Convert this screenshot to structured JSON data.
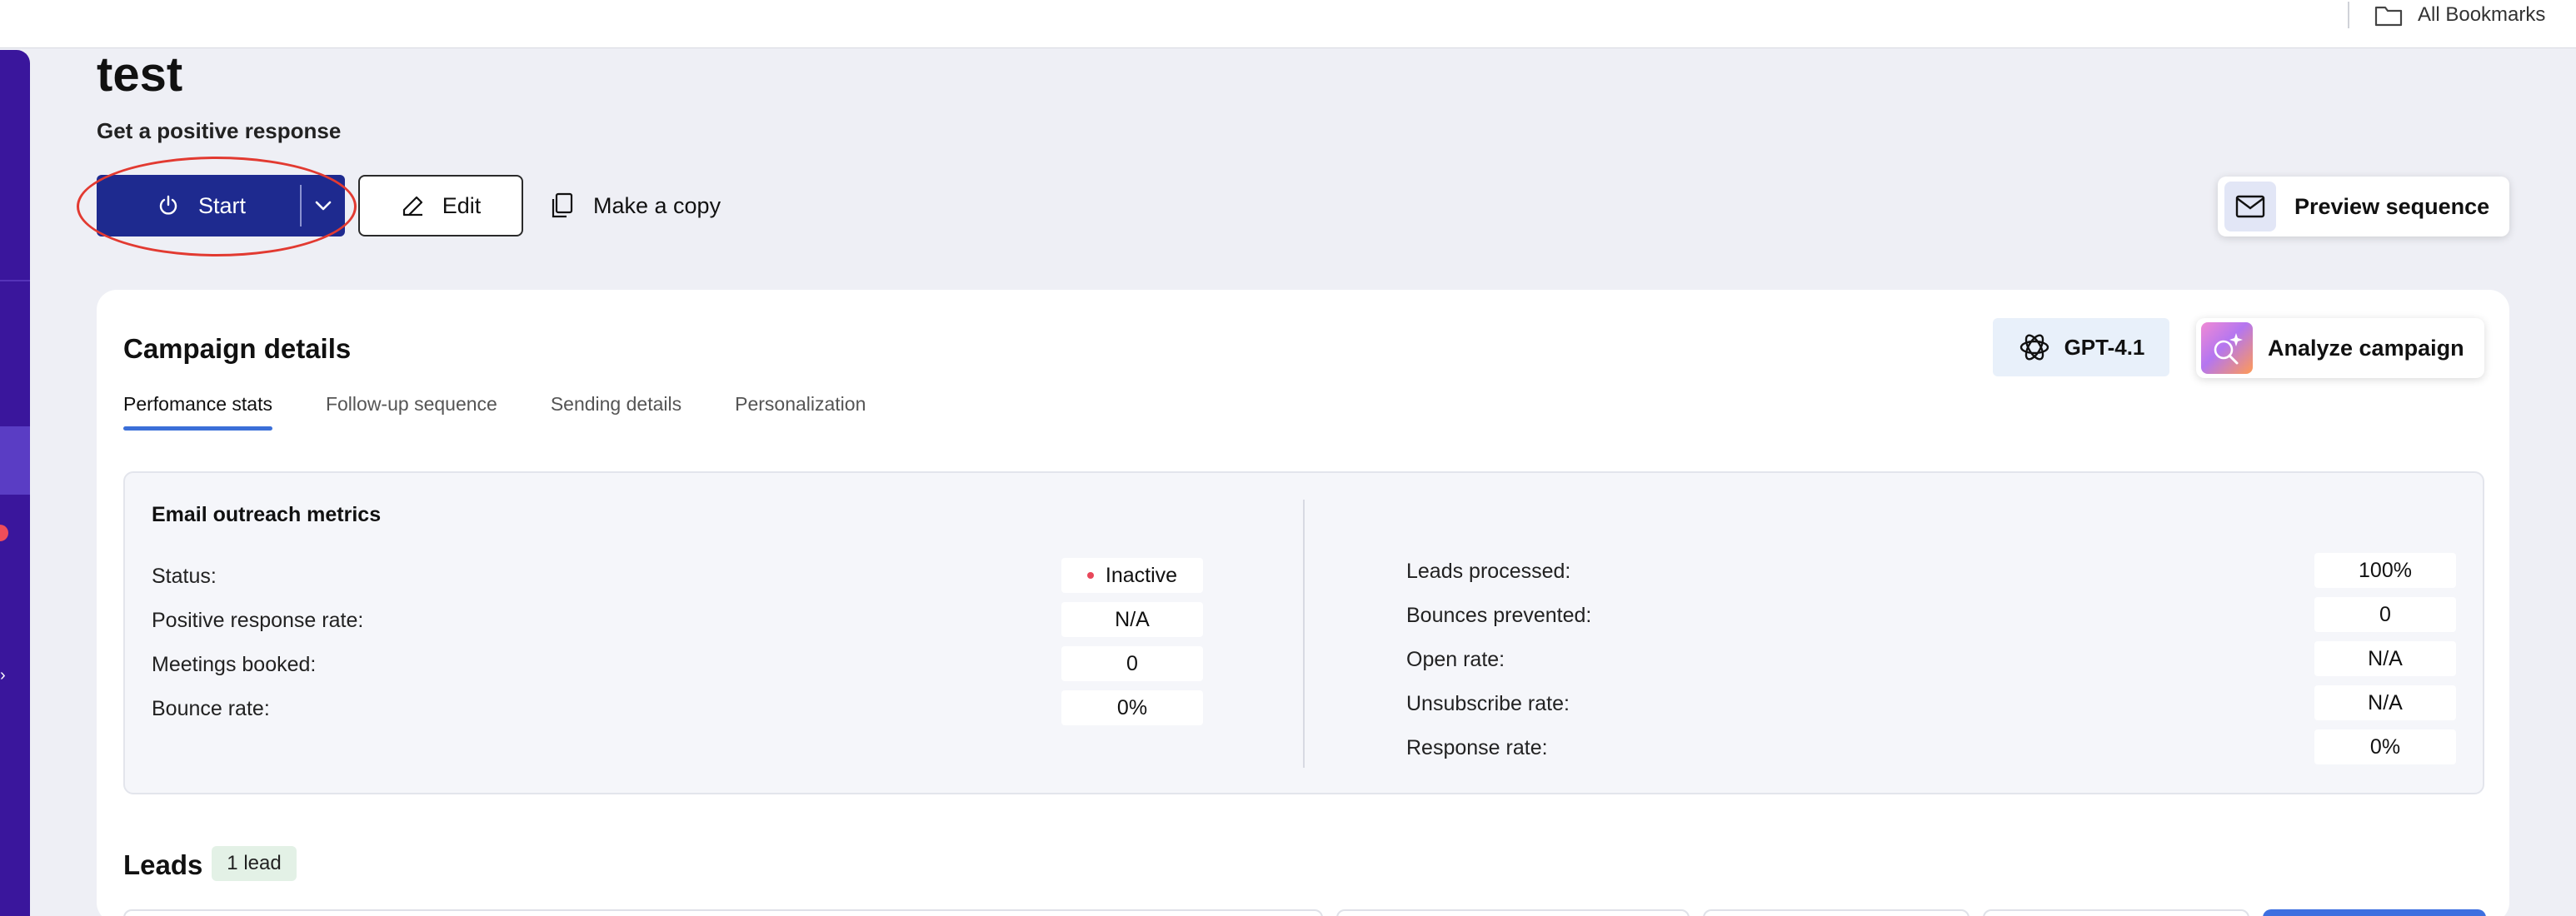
{
  "bookmarks": {
    "label": "All Bookmarks",
    "icon": "folder-icon"
  },
  "page": {
    "title": "test",
    "subtitle": "Get a positive response"
  },
  "actions": {
    "start_label": "Start",
    "edit_label": "Edit",
    "copy_label": "Make a copy",
    "preview_label": "Preview sequence"
  },
  "campaign": {
    "title": "Campaign details",
    "gpt_label": "GPT-4.1",
    "analyze_label": "Analyze campaign",
    "tabs": [
      {
        "label": "Perfomance stats",
        "active": true
      },
      {
        "label": "Follow-up sequence",
        "active": false
      },
      {
        "label": "Sending details",
        "active": false
      },
      {
        "label": "Personalization",
        "active": false
      }
    ],
    "metrics": {
      "title": "Email outreach metrics",
      "left": [
        {
          "label": "Status:",
          "value": "Inactive"
        },
        {
          "label": "Positive response rate:",
          "value": "N/A"
        },
        {
          "label": "Meetings booked:",
          "value": "0"
        },
        {
          "label": "Bounce rate:",
          "value": "0%"
        }
      ],
      "right": [
        {
          "label": "Leads processed:",
          "value": "100%"
        },
        {
          "label": "Bounces prevented:",
          "value": "0"
        },
        {
          "label": "Open rate:",
          "value": "N/A"
        },
        {
          "label": "Unsubscribe rate:",
          "value": "N/A"
        },
        {
          "label": "Response rate:",
          "value": "0%"
        }
      ]
    }
  },
  "leads": {
    "title": "Leads",
    "badge": "1 lead"
  },
  "colors": {
    "sidebar": "#3a169c",
    "start_button": "#1e2a8f",
    "active_tab_underline": "#3b6fd8",
    "highlight_ellipse": "#e23a31",
    "status_inactive_dot": "#e8475a"
  }
}
